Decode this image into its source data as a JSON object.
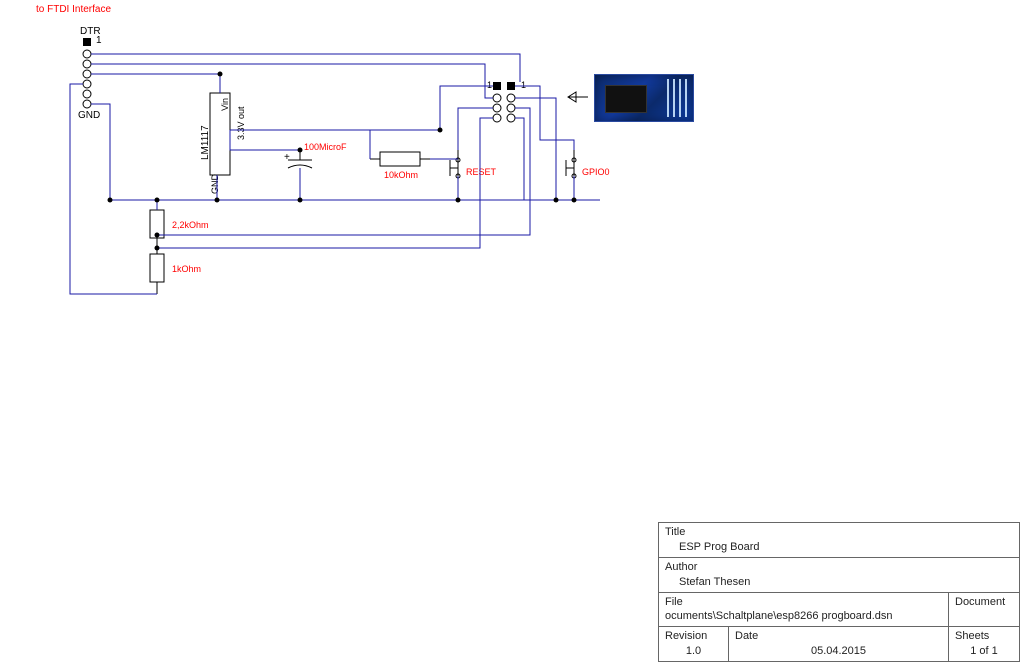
{
  "labels": {
    "ftdi": "to FTDI Interface",
    "dtr": "DTR",
    "gnd_conn": "GND",
    "pin1_conn": "1",
    "reg_name": "LM1117",
    "reg_vin": "Vin",
    "reg_gnd": "GND",
    "reg_out": "3.3V out",
    "cap": "100MicroF",
    "r10k": "10kOhm",
    "reset_sw": "RESET",
    "gpio0_sw": "GPIO0",
    "r2_2k": "2,2kOhm",
    "r1k": "1kOhm",
    "pin1_esp": "1",
    "pin1_espR": "1"
  },
  "title_block": {
    "title_head": "Title",
    "title_val": "ESP Prog Board",
    "author_head": "Author",
    "author_val": "Stefan Thesen",
    "file_head": "File",
    "file_val": "ocuments\\Schaltplane\\esp8266 progboard.dsn",
    "doc_head": "Document",
    "doc_val": "",
    "rev_head": "Revision",
    "rev_val": "1.0",
    "date_head": "Date",
    "date_val": "05.04.2015",
    "sheets_head": "Sheets",
    "sheets_val": "1 of 1"
  }
}
